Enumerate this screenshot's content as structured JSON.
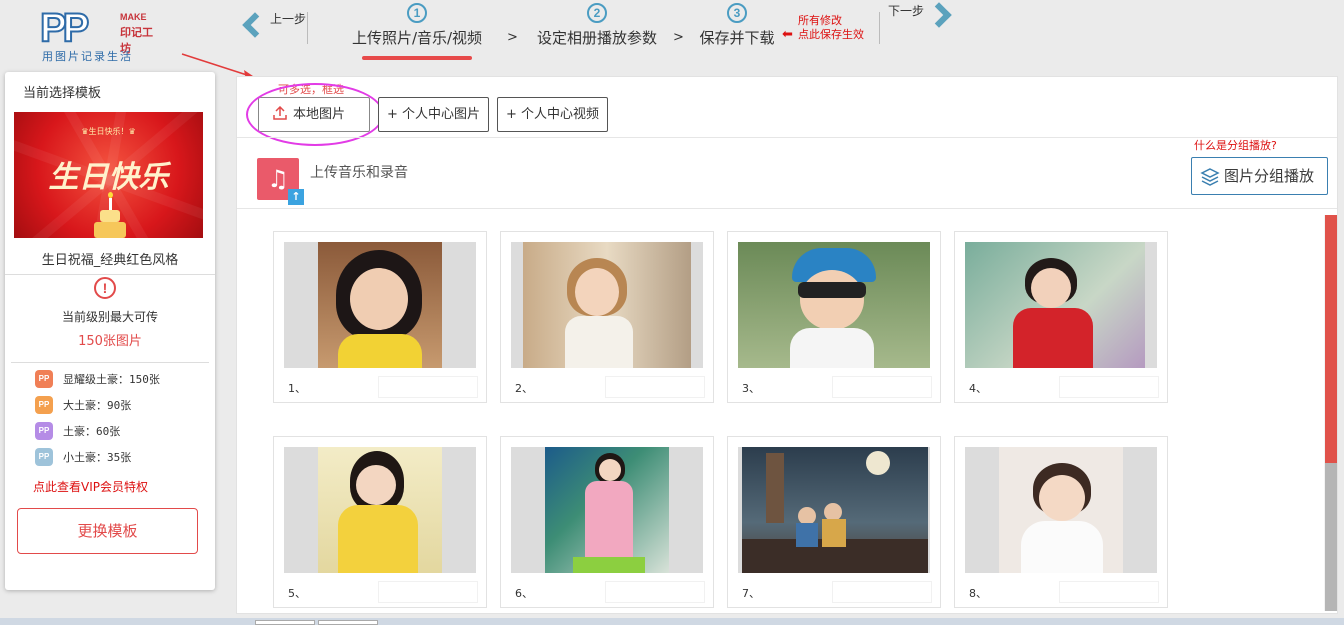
{
  "logo": {
    "letters": "PP",
    "make": "MAKE",
    "brand": "印记工坊",
    "slogan": "用图片记录生活"
  },
  "nav": {
    "prev_label": "上一步",
    "next_label": "下一步"
  },
  "steps": [
    {
      "num": "1",
      "label": "上传照片/音乐/视频",
      "active": true
    },
    {
      "num": "2",
      "label": "设定相册播放参数",
      "active": false
    },
    {
      "num": "3",
      "label": "保存并下载",
      "active": false
    }
  ],
  "step_separator": ">",
  "save_note": {
    "arrow": "⬅",
    "line1": "所有修改",
    "line2": "点此保存生效"
  },
  "sidebar": {
    "title": "当前选择模板",
    "thumb_small_caption": "♛生日快乐！♛",
    "thumb_big_caption": "生日快乐",
    "template_name": "生日祝福_经典红色风格",
    "warn_glyph": "!",
    "limit_line1": "当前级别最大可传",
    "limit_line2": "150张图片",
    "levels": [
      {
        "label": "显耀级土豪：150张",
        "color": "#f07f56"
      },
      {
        "label": "大土豪：90张",
        "color": "#f4a04e"
      },
      {
        "label": "土豪：60张",
        "color": "#b58ce6"
      },
      {
        "label": "小土豪：35张",
        "color": "#9ec3da"
      }
    ],
    "badge_text": "PP",
    "vip_link": "点此查看VIP会员特权",
    "change_button": "更换模板"
  },
  "toolbar": {
    "hint": "可多选，框选",
    "local_button": "本地图片",
    "center_photo_button": "+ 个人中心图片",
    "center_video_button": "+ 个人中心视频"
  },
  "music": {
    "icon_glyph": "♫",
    "upload_glyph": "↑",
    "label": "上传音乐和录音"
  },
  "group": {
    "question": "什么是分组播放?",
    "button": "图片分组播放"
  },
  "photos": [
    {
      "index": "1、",
      "subject": "girl-yellow-dress"
    },
    {
      "index": "2、",
      "subject": "girl-arms-crossed"
    },
    {
      "index": "3、",
      "subject": "boy-cap-sunglasses"
    },
    {
      "index": "4、",
      "subject": "girl-red-hanfu"
    },
    {
      "index": "5、",
      "subject": "girl-yellow-costume"
    },
    {
      "index": "6、",
      "subject": "girl-pink-costume"
    },
    {
      "index": "7、",
      "subject": "kids-rooftop-night"
    },
    {
      "index": "8、",
      "subject": "baby-white-dress"
    }
  ],
  "colors": {
    "accent_red": "#e24a4a",
    "accent_blue": "#4a9cc2",
    "highlight_magenta": "#e23be6"
  }
}
